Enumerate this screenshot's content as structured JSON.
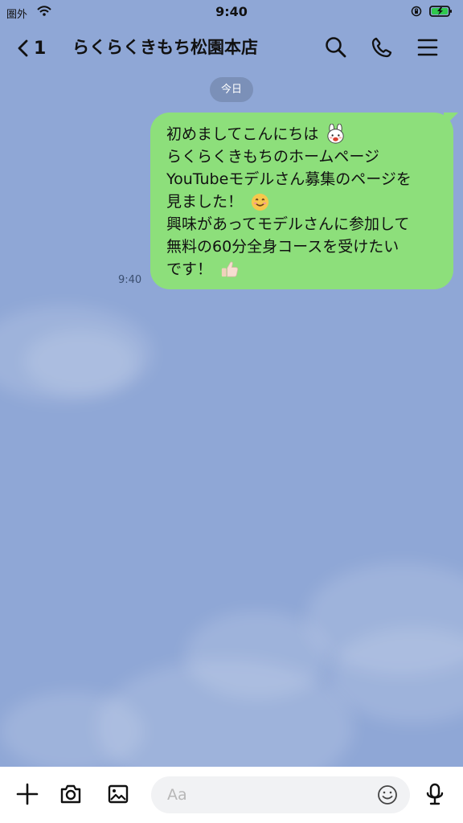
{
  "status_bar": {
    "carrier": "圏外",
    "time": "9:40",
    "icons": [
      "wifi-icon",
      "lock-icon",
      "battery-icon"
    ]
  },
  "header": {
    "back_count": "1",
    "title": "らくらくきもち松園本店",
    "icons": [
      "search-icon",
      "phone-icon",
      "menu-icon"
    ]
  },
  "chat": {
    "date_label": "今日",
    "messages": [
      {
        "time": "9:40",
        "lines": [
          "初めましてこんにちは",
          "らくらくきもちのホームページ",
          "YouTubeモデルさん募集のページを",
          "見ました！",
          "興味があってモデルさんに参加して",
          "無料の60分全身コースを受けたい",
          "です！"
        ],
        "emojis": [
          "rabbit-sticker-icon",
          "smile-icon",
          "thumbs-up-icon"
        ]
      }
    ]
  },
  "composer": {
    "placeholder": "Aa",
    "icons": [
      "plus-icon",
      "camera-icon",
      "image-icon",
      "emoji-icon",
      "mic-icon"
    ]
  },
  "colors": {
    "chat_background": "#8fa7d6",
    "sent_bubble": "#8ddf7b",
    "date_chip": "#7488ad",
    "composer_background": "#ffffff",
    "input_background": "#f1f2f4"
  }
}
